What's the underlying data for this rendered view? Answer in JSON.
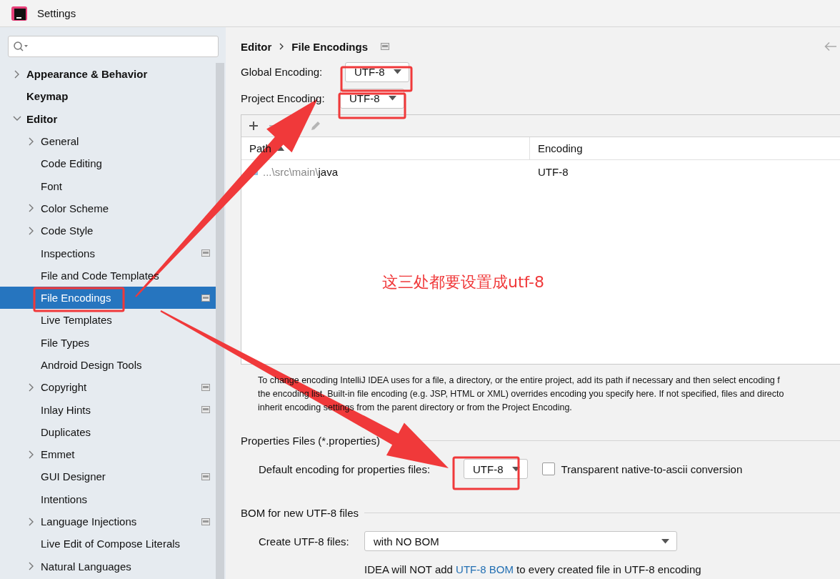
{
  "window": {
    "title": "Settings"
  },
  "sidebar": {
    "items": [
      {
        "label": "Appearance & Behavior",
        "expanded": false,
        "selected": false,
        "scope_icon": false
      },
      {
        "label": "Keymap",
        "selected": false,
        "scope_icon": false
      },
      {
        "label": "Editor",
        "expanded": true,
        "selected": false,
        "scope_icon": false,
        "children": [
          {
            "label": "General",
            "expanded": false,
            "selected": false,
            "scope_icon": false
          },
          {
            "label": "Code Editing",
            "selected": false,
            "scope_icon": false
          },
          {
            "label": "Font",
            "selected": false,
            "scope_icon": false
          },
          {
            "label": "Color Scheme",
            "expanded": false,
            "selected": false,
            "scope_icon": false
          },
          {
            "label": "Code Style",
            "expanded": false,
            "selected": false,
            "scope_icon": false
          },
          {
            "label": "Inspections",
            "selected": false,
            "scope_icon": true
          },
          {
            "label": "File and Code Templates",
            "selected": false,
            "scope_icon": false
          },
          {
            "label": "File Encodings",
            "selected": true,
            "scope_icon": true
          },
          {
            "label": "Live Templates",
            "selected": false,
            "scope_icon": false
          },
          {
            "label": "File Types",
            "selected": false,
            "scope_icon": false
          },
          {
            "label": "Android Design Tools",
            "selected": false,
            "scope_icon": false
          },
          {
            "label": "Copyright",
            "expanded": false,
            "selected": false,
            "scope_icon": true
          },
          {
            "label": "Inlay Hints",
            "selected": false,
            "scope_icon": true
          },
          {
            "label": "Duplicates",
            "selected": false,
            "scope_icon": false
          },
          {
            "label": "Emmet",
            "expanded": false,
            "selected": false,
            "scope_icon": false
          },
          {
            "label": "GUI Designer",
            "selected": false,
            "scope_icon": true
          },
          {
            "label": "Intentions",
            "selected": false,
            "scope_icon": false
          },
          {
            "label": "Language Injections",
            "expanded": false,
            "selected": false,
            "scope_icon": true
          },
          {
            "label": "Live Edit of Compose Literals",
            "selected": false,
            "scope_icon": false
          },
          {
            "label": "Natural Languages",
            "expanded": false,
            "selected": false,
            "scope_icon": false
          }
        ]
      }
    ]
  },
  "breadcrumb": [
    "Editor",
    "File Encodings"
  ],
  "global_encoding": {
    "label": "Global Encoding:",
    "value": "UTF-8"
  },
  "project_encoding": {
    "label": "Project Encoding:",
    "value": "UTF-8"
  },
  "table": {
    "columns": [
      {
        "label": "Path",
        "sorted_ascending": true
      },
      {
        "label": "Encoding"
      }
    ],
    "rows": [
      {
        "path_prefix": "...\\src\\main\\",
        "path_name": "java",
        "encoding": "UTF-8"
      }
    ]
  },
  "help_lines": [
    "To change encoding IntelliJ IDEA uses for a file, a directory, or the entire project, add its path if necessary and then select encoding f",
    "the encoding list. Built-in file encoding (e.g. JSP, HTML or XML) overrides encoding you specify here. If not specified, files and directo",
    "inherit encoding settings from the parent directory or from the Project Encoding."
  ],
  "properties_section": {
    "title": "Properties Files (*.properties)",
    "label": "Default encoding for properties files:",
    "value": "UTF-8",
    "checkbox": {
      "label": "Transparent native-to-ascii conversion",
      "checked": false
    }
  },
  "bom_section": {
    "title": "BOM for new UTF-8 files",
    "label": "Create UTF-8 files:",
    "value": "with NO BOM",
    "note_before": "IDEA will NOT add ",
    "note_link": "UTF-8 BOM",
    "note_after": " to every created file in UTF-8 encoding"
  },
  "annotation": {
    "note": "这三处都要设置成utf-8"
  }
}
